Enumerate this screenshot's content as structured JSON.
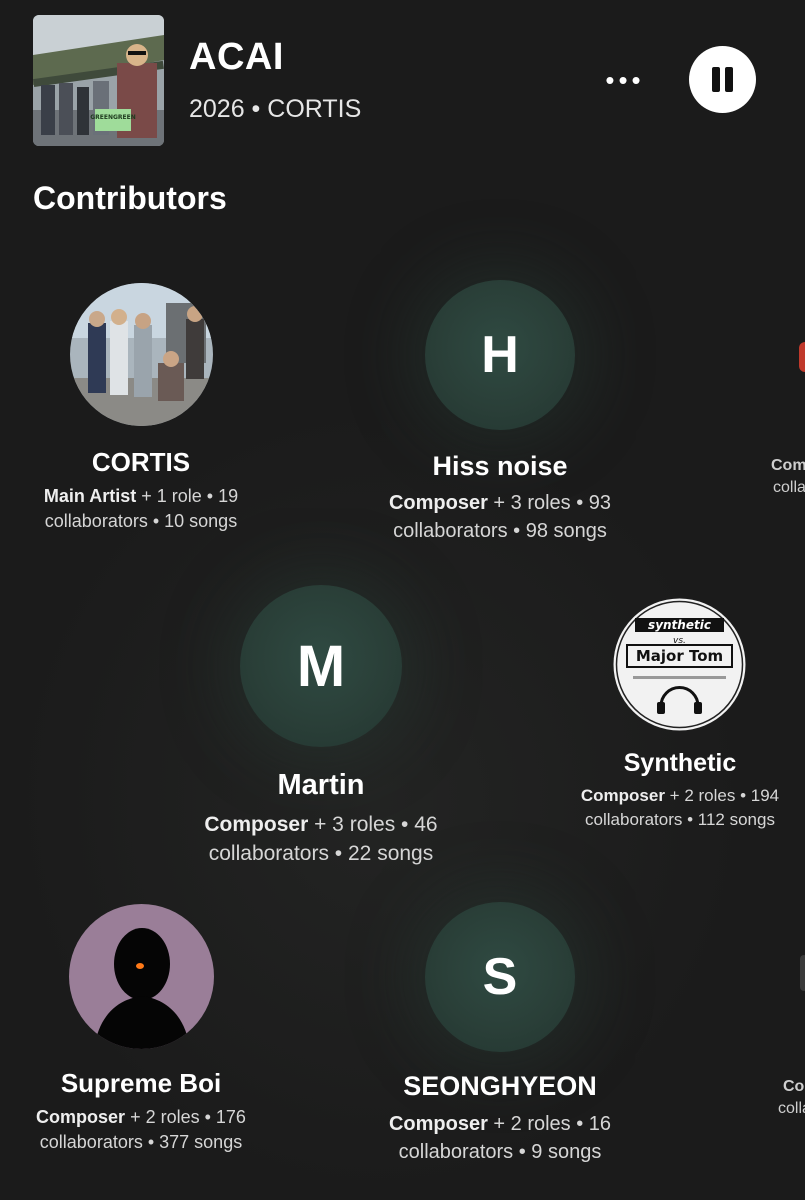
{
  "track": {
    "title": "ACAI",
    "subtitle": "2026 • CORTIS",
    "more_label": "•••",
    "album_art_text": "GREENGREEN"
  },
  "section": {
    "title": "Contributors"
  },
  "contributors": [
    {
      "name": "CORTIS",
      "role": "Main Artist",
      "rest": " + 1 role • 19",
      "line2": "collaborators • 10 songs"
    },
    {
      "name": "Hiss noise",
      "initial": "H",
      "role": "Composer",
      "rest": " + 3 roles • 93",
      "line2": "collaborators • 98 songs"
    },
    {
      "name": "Martin",
      "initial": "M",
      "role": "Composer",
      "rest": " + 3 roles • 46",
      "line2": "collaborators • 22 songs"
    },
    {
      "name": "Synthetic",
      "role": "Composer",
      "rest": " + 2 roles • 194",
      "line2": "collaborators • 112 songs",
      "art_text_1": "synthetic",
      "art_text_2": "vs.",
      "art_text_3": "Major Tom"
    },
    {
      "name": "Supreme Boi",
      "role": "Composer",
      "rest": " + 2 roles • 176",
      "line2": "collaborators • 377 songs"
    },
    {
      "name": "SEONGHYEON",
      "initial": "S",
      "role": "Composer",
      "rest": " + 2 roles • 16",
      "line2": "collaborators • 9 songs"
    }
  ],
  "edge_right": {
    "top_line1": "Com",
    "top_line2": "colla",
    "bottom_line1": "Co",
    "bottom_line2": "colla"
  },
  "colors": {
    "background": "#1b1b1b",
    "avatar_green": "#2a3f38"
  }
}
